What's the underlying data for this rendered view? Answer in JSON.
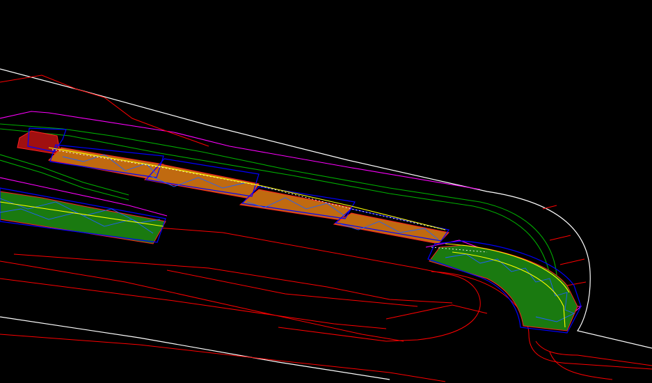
{
  "viewport": {
    "background": "#000000"
  },
  "palette": {
    "edge_line": "#ffffff",
    "red_line": "#ff0000",
    "magenta_line": "#ff00ff",
    "green_line": "#00c000",
    "blue_outline": "#0000ff",
    "yellow_centerline": "#ffff00",
    "orange_fill": "#c06a10",
    "green_fill": "#1a7a10",
    "red_fill": "#a01010"
  },
  "layers": [
    {
      "name": "road-edge",
      "color_key": "edge_line",
      "icon": "polyline"
    },
    {
      "name": "offsets",
      "color_key": "red_line",
      "icon": "polyline"
    },
    {
      "name": "boundary",
      "color_key": "magenta_line",
      "icon": "polyline"
    },
    {
      "name": "kerb",
      "color_key": "green_line",
      "icon": "polyline"
    },
    {
      "name": "bays",
      "color_key": "blue_outline",
      "icon": "polygon"
    },
    {
      "name": "centerline",
      "color_key": "yellow_centerline",
      "icon": "polyline"
    }
  ]
}
